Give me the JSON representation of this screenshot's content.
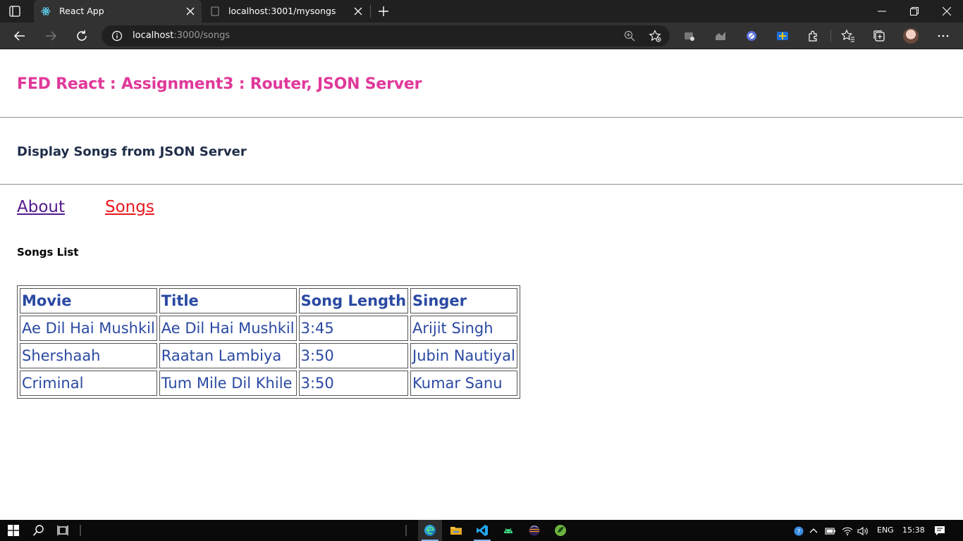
{
  "browser": {
    "tabs": [
      {
        "title": "React App",
        "active": true
      },
      {
        "title": "localhost:3001/mysongs",
        "active": false
      }
    ],
    "address": {
      "host": "localhost",
      "path": ":3000/songs"
    }
  },
  "page": {
    "app_title": "FED React : Assignment3 : Router, JSON Server",
    "subtitle": "Display Songs from JSON Server",
    "nav": {
      "about": "About",
      "songs": "Songs"
    },
    "list_heading": "Songs List",
    "table": {
      "headers": [
        "Movie",
        "Title",
        "Song Length",
        "Singer"
      ],
      "rows": [
        [
          "Ae Dil Hai Mushkil",
          "Ae Dil Hai Mushkil",
          "3:45",
          "Arijit Singh"
        ],
        [
          "Shershaah",
          "Raatan Lambiya",
          "3:50",
          "Jubin Nautiyal"
        ],
        [
          "Criminal",
          "Tum Mile Dil Khile",
          "3:50",
          "Kumar Sanu"
        ]
      ]
    }
  },
  "taskbar": {
    "language": "ENG",
    "clock": "15:38"
  },
  "colors": {
    "app_title": "#e0389a",
    "subtitle": "#1f2d49",
    "table_text": "#2a49a2",
    "link_visited": "#551a8b",
    "link_active": "#e8191f"
  }
}
